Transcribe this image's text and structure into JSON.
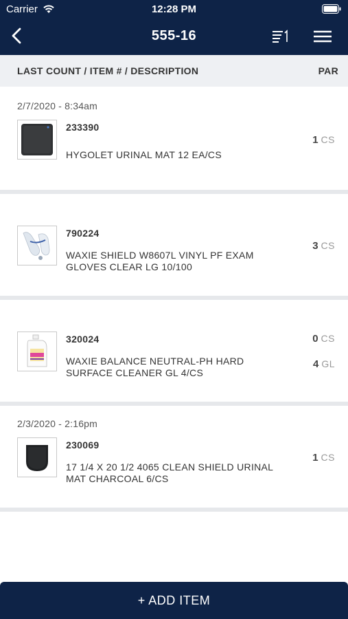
{
  "status_bar": {
    "carrier": "Carrier",
    "time": "12:28 PM"
  },
  "nav": {
    "title": "555-16",
    "back_icon": "chevron-left-icon",
    "sort_icon": "sort-list-icon",
    "menu_icon": "hamburger-menu-icon"
  },
  "table_header": {
    "left": "LAST COUNT / ITEM # / DESCRIPTION",
    "right": "PAR"
  },
  "items": [
    {
      "date": "2/7/2020 - 8:34am",
      "number": "233390",
      "description": "HYGOLET URINAL MAT 12 EA/CS",
      "par": [
        {
          "qty": "1",
          "unit": "CS"
        }
      ],
      "image": "black-mat-icon"
    },
    {
      "date": "",
      "number": "790224",
      "description": "WAXIE SHIELD W8607L VINYL PF EXAM GLOVES CLEAR LG 10/100",
      "par": [
        {
          "qty": "3",
          "unit": "CS"
        }
      ],
      "image": "gloves-icon"
    },
    {
      "date": "",
      "number": "320024",
      "description": "WAXIE BALANCE NEUTRAL-PH HARD SURFACE CLEANER GL 4/CS",
      "par": [
        {
          "qty": "0",
          "unit": "CS"
        },
        {
          "qty": "4",
          "unit": "GL"
        }
      ],
      "image": "cleaner-jug-icon"
    },
    {
      "date": "2/3/2020 - 2:16pm",
      "number": "230069",
      "description": "17 1/4 X 20 1/2 4065 CLEAN SHIELD URINAL MAT CHARCOAL 6/CS",
      "par": [
        {
          "qty": "1",
          "unit": "CS"
        }
      ],
      "image": "charcoal-mat-icon"
    }
  ],
  "add_button": {
    "label": "+ ADD ITEM"
  },
  "colors": {
    "navy": "#0e2347",
    "header_gray": "#eef0f3",
    "divider": "#e6e8eb"
  }
}
